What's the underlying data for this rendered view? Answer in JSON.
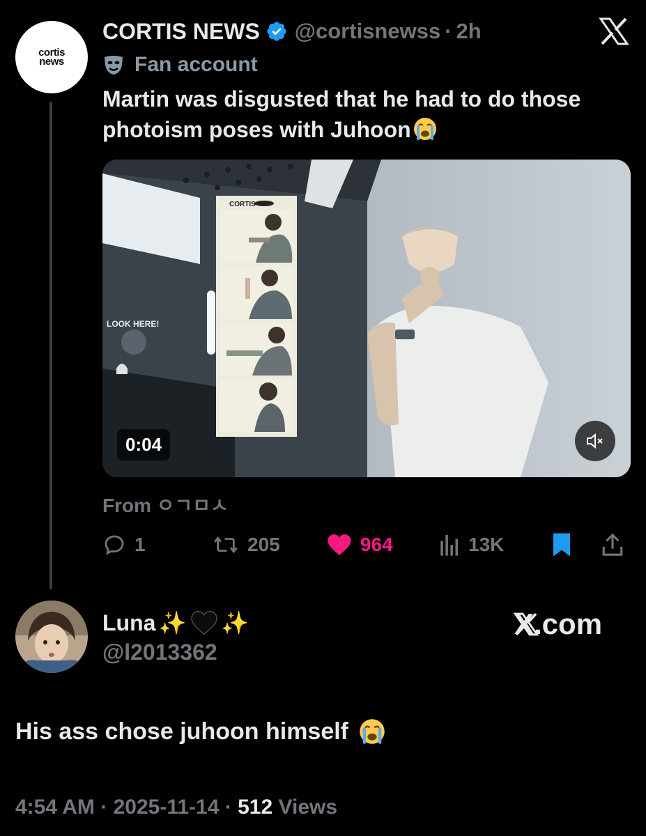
{
  "tweet": {
    "avatar_text_line1": "cortis",
    "avatar_text_line2": "news",
    "display_name": "CORTIS NEWS",
    "handle": "@cortisnewss",
    "separator": "·",
    "time": "2h",
    "fan_label": "Fan account",
    "text": "Martin was disgusted that he had to do those photoism poses with Juhoon",
    "media": {
      "timestamp": "0:04",
      "photo_strip_brand": "CORTIS",
      "booth_sign": "LOOK HERE!"
    },
    "from_label": "From ㅇㄱㅁㅅ",
    "actions": {
      "replies": "1",
      "retweets": "205",
      "likes": "964",
      "views": "13K"
    },
    "colors": {
      "like": "#f91880",
      "bookmark": "#1d9bf0",
      "verified": "#1d9bf0"
    }
  },
  "reply": {
    "display_name": "Luna",
    "handle": "@l2013362",
    "site": "X.com",
    "text": "His ass chose juhoon himself",
    "footer": {
      "time": "4:54 AM",
      "date": "2025-11-14",
      "views_count": "512",
      "views_label": "Views",
      "separator": "·"
    }
  },
  "icons": [
    "verified-badge-icon",
    "x-logo-icon",
    "fan-mask-icon",
    "crying-emoji",
    "mute-icon",
    "reply-icon",
    "retweet-icon",
    "heart-icon",
    "views-icon",
    "bookmark-icon",
    "share-icon",
    "sparkles-emoji",
    "black-heart-emoji"
  ]
}
